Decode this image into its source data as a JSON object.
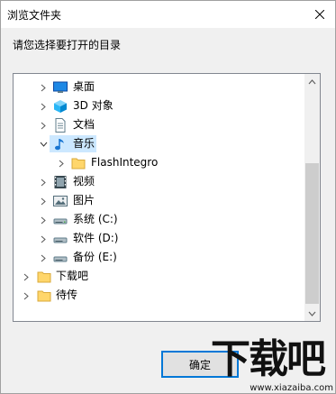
{
  "window": {
    "title": "浏览文件夹"
  },
  "prompt": "请您选择要打开的目录",
  "tree": {
    "items": [
      {
        "label": "桌面",
        "icon": "desktop-icon",
        "expanded": false,
        "selected": false
      },
      {
        "label": "3D 对象",
        "icon": "3d-objects-icon",
        "expanded": false,
        "selected": false
      },
      {
        "label": "文档",
        "icon": "document-icon",
        "expanded": false,
        "selected": false
      },
      {
        "label": "音乐",
        "icon": "music-icon",
        "expanded": true,
        "selected": true
      },
      {
        "label": "FlashIntegro",
        "icon": "folder-icon",
        "expanded": false,
        "selected": false
      },
      {
        "label": "视频",
        "icon": "video-icon",
        "expanded": false,
        "selected": false
      },
      {
        "label": "图片",
        "icon": "picture-icon",
        "expanded": false,
        "selected": false
      },
      {
        "label": "系统 (C:)",
        "icon": "drive-icon",
        "expanded": false,
        "selected": false
      },
      {
        "label": "软件 (D:)",
        "icon": "drive-icon",
        "expanded": false,
        "selected": false
      },
      {
        "label": "备份 (E:)",
        "icon": "drive-icon",
        "expanded": false,
        "selected": false
      },
      {
        "label": "下载吧",
        "icon": "folder-icon",
        "expanded": false,
        "selected": false
      },
      {
        "label": "待传",
        "icon": "folder-icon",
        "expanded": false,
        "selected": false
      }
    ]
  },
  "buttons": {
    "ok_label": "确定"
  },
  "watermark": {
    "text": "下载吧",
    "url": "www.xiazaiba.com"
  },
  "colors": {
    "selection": "#cce8ff",
    "accent": "#0078d7",
    "folder": "#ffd66b"
  }
}
